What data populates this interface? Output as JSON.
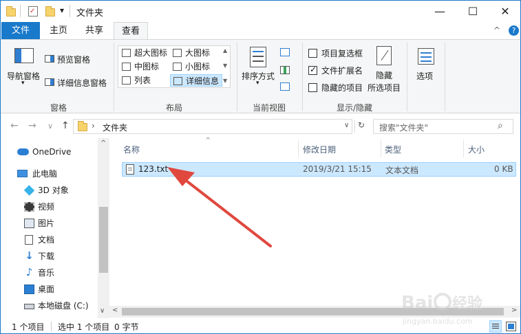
{
  "window": {
    "title": "文件夹",
    "controls": {
      "minimize": "—",
      "maximize": "☐",
      "close": "✕"
    }
  },
  "quick_access": {
    "dropdown": "▾"
  },
  "tabs": [
    {
      "label": "文件"
    },
    {
      "label": "主页"
    },
    {
      "label": "共享"
    },
    {
      "label": "查看"
    }
  ],
  "ribbon": {
    "collapse_icon": "^",
    "help_icon": "?",
    "groups": {
      "panes": {
        "label": "窗格",
        "nav_pane": "导航窗格",
        "preview_pane": "预览窗格",
        "details_pane": "详细信息窗格"
      },
      "layout": {
        "label": "布局",
        "items": [
          "超大图标",
          "大图标",
          "中图标",
          "小图标",
          "列表",
          "详细信息"
        ]
      },
      "current_view": {
        "label": "当前视图",
        "sort_by": "排序方式"
      },
      "show_hide": {
        "label": "显示/隐藏",
        "item_checkboxes": "项目复选框",
        "file_extensions": "文件扩展名",
        "hidden_items": "隐藏的项目",
        "hide_selected_line1": "隐藏",
        "hide_selected_line2": "所选项目",
        "checks": {
          "item_checkboxes": false,
          "file_extensions": true,
          "hidden_items": false
        }
      },
      "options": {
        "label": "选项"
      }
    }
  },
  "navbar": {
    "back": "←",
    "forward": "→",
    "recent": "∨",
    "up": "↑",
    "address_sep": "›",
    "address": "文件夹",
    "address_dropdown": "∨",
    "refresh": "↻",
    "search_placeholder": "搜索\"文件夹\"",
    "search_icon": "⌕"
  },
  "nav_pane": {
    "items": [
      "OneDrive",
      "此电脑",
      "3D 对象",
      "视频",
      "图片",
      "文档",
      "下载",
      "音乐",
      "桌面",
      "本地磁盘 (C:)"
    ],
    "scroll_up": "^",
    "scroll_down": "∨"
  },
  "content": {
    "columns": {
      "name": "名称",
      "modified": "修改日期",
      "type": "类型",
      "size": "大小"
    },
    "sort_indicator": "^",
    "files": [
      {
        "name": "123.txt",
        "modified": "2019/3/21 15:15",
        "type": "文本文档",
        "size": "0 KB"
      }
    ],
    "scroll_left": "<",
    "scroll_right": ">"
  },
  "status": {
    "count": "1 个项目",
    "selected": "选中 1 个项目",
    "size": "0 字节"
  },
  "colors": {
    "accent": "#1979ca",
    "selection": "#cce8ff",
    "selection_border": "#99d1ff",
    "arrow": "#e0483e"
  }
}
